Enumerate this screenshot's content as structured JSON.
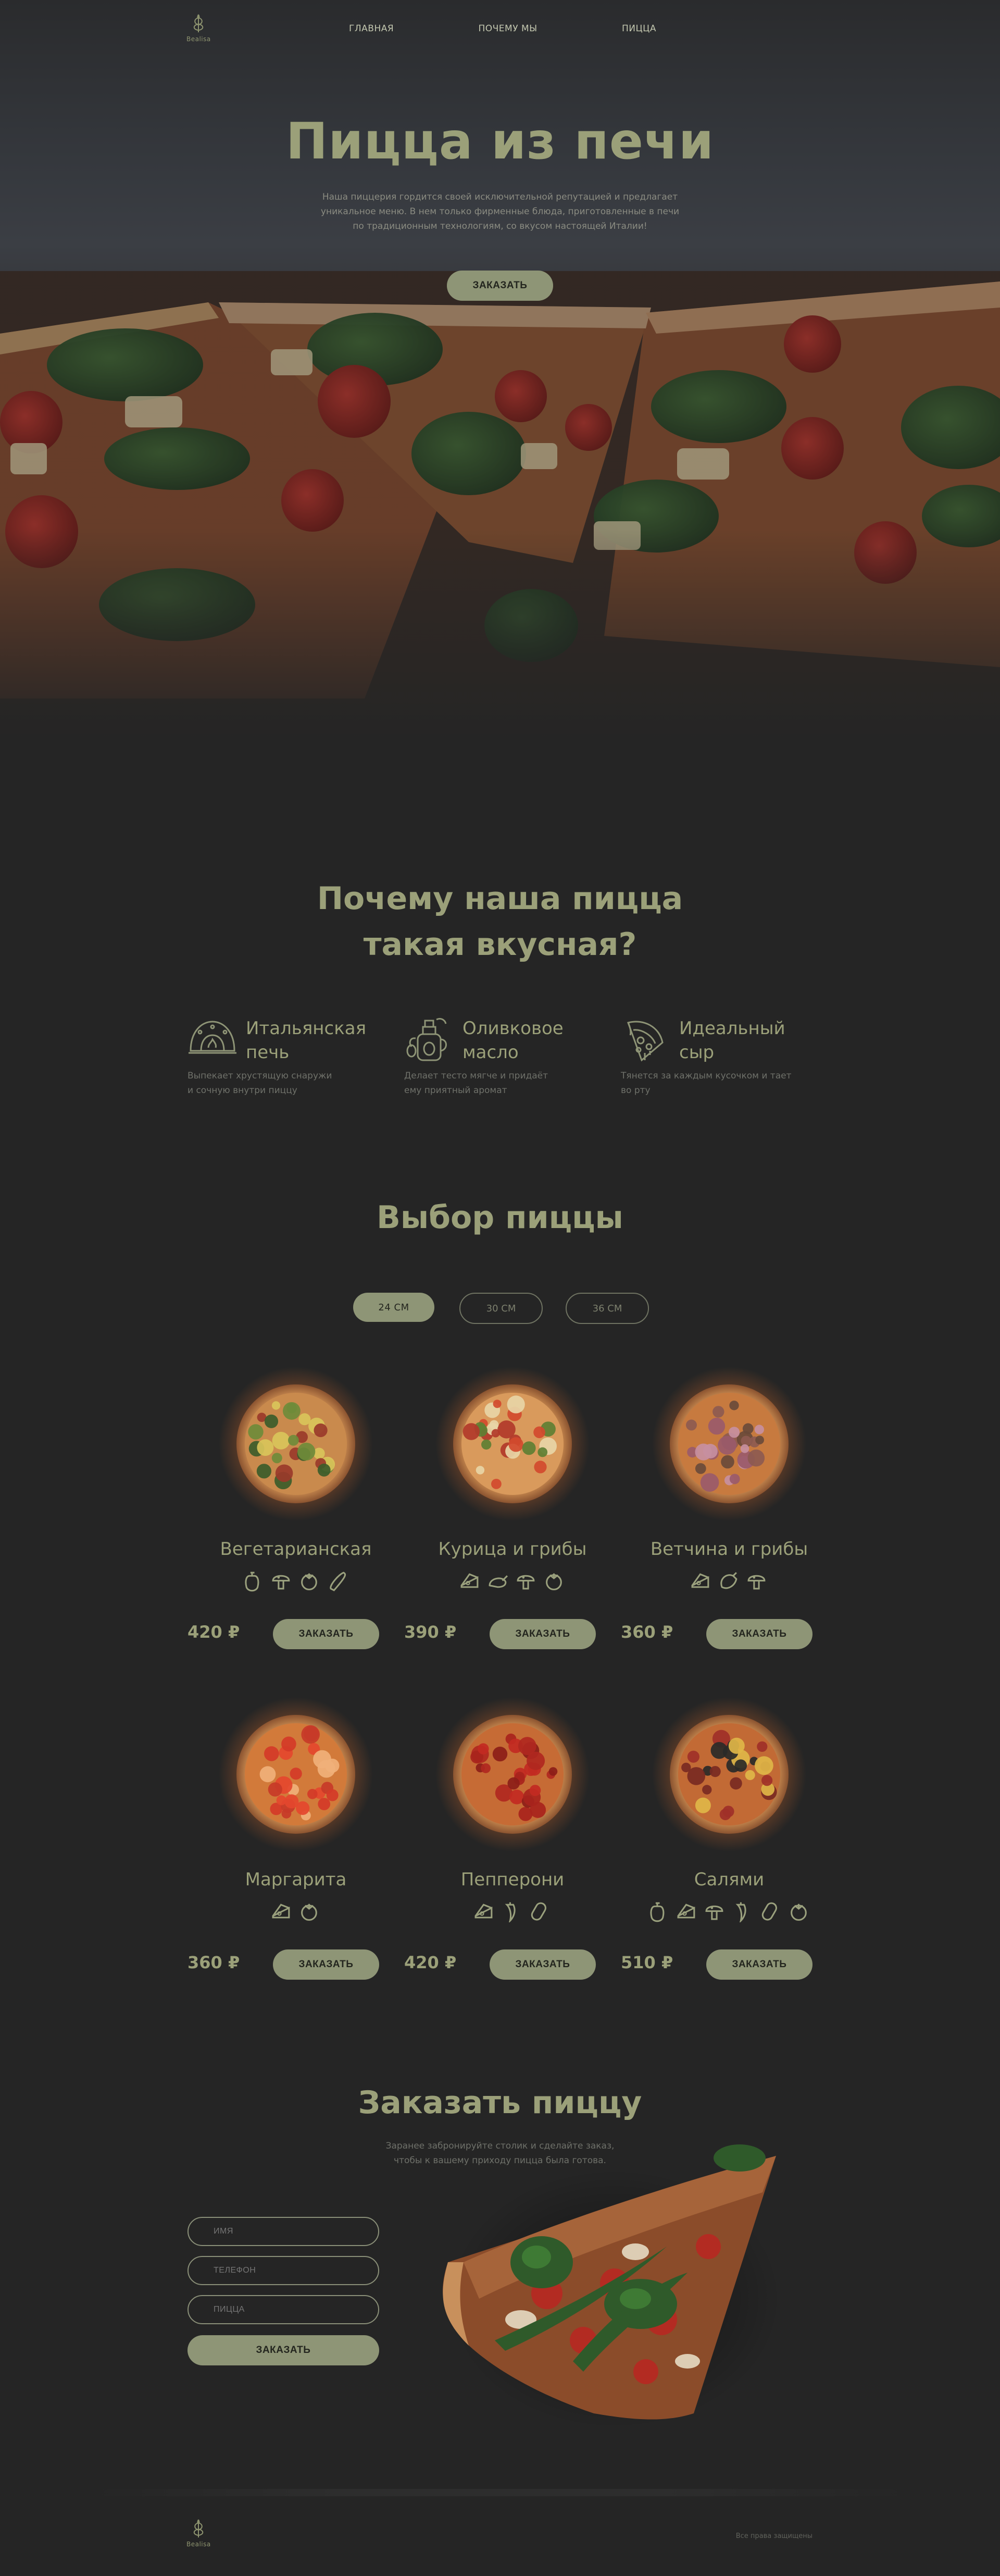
{
  "header": {
    "logo_text": "Bealisa",
    "nav": [
      "ГЛАВНАЯ",
      "ПОЧЕМУ МЫ",
      "ПИЦЦА"
    ]
  },
  "hero": {
    "title": "Пицца из печи",
    "subtitle_lines": [
      "Наша пиццерия гордится своей исключительной репутацией и предлагает",
      "уникальное меню. В нем только фирменные блюда, приготовленные в печи",
      "по традиционным технологиям, со вкусом настоящей Италии!"
    ],
    "cta": "ЗАКАЗАТЬ"
  },
  "why": {
    "title_lines": [
      "Почему наша пицца",
      "такая вкусная?"
    ],
    "features": [
      {
        "icon": "oven-icon",
        "title_lines": [
          "Итальянская",
          "печь"
        ],
        "desc_lines": [
          "Выпекает хрустящую снаружи",
          "и сочную внутри пиццу"
        ]
      },
      {
        "icon": "olive-oil-icon",
        "title_lines": [
          "Оливковое",
          "масло"
        ],
        "desc_lines": [
          "Делает тесто мягче и придаёт",
          "ему приятный аромат"
        ]
      },
      {
        "icon": "cheese-pizza-icon",
        "title_lines": [
          "Идеальный",
          "сыр"
        ],
        "desc_lines": [
          "Тянется за каждым кусочком и тает",
          "во рту"
        ]
      }
    ]
  },
  "menu": {
    "title": "Выбор пиццы",
    "sizes": [
      "24 СМ",
      "30 СМ",
      "36 СМ"
    ],
    "active_size": "24 СМ",
    "order_label": "ЗАКАЗАТЬ",
    "pizzas": [
      {
        "name": "Вегетарианская",
        "price": "420 ₽",
        "ingredients": [
          "pepper-icon",
          "mushroom-icon",
          "tomato-icon",
          "zucchini-icon"
        ]
      },
      {
        "name": "Курица и грибы",
        "price": "390 ₽",
        "ingredients": [
          "cheese-icon",
          "chicken-icon",
          "mushroom-icon",
          "tomato-icon"
        ]
      },
      {
        "name": "Ветчина и грибы",
        "price": "360 ₽",
        "ingredients": [
          "cheese-icon",
          "ham-icon",
          "mushroom-icon"
        ]
      },
      {
        "name": "Маргарита",
        "price": "360 ₽",
        "ingredients": [
          "cheese-icon",
          "tomato-icon"
        ]
      },
      {
        "name": "Пепперони",
        "price": "420 ₽",
        "ingredients": [
          "cheese-icon",
          "chili-icon",
          "sausage-icon"
        ]
      },
      {
        "name": "Салями",
        "price": "510 ₽",
        "ingredients": [
          "pepper-icon",
          "cheese-icon",
          "mushroom-icon",
          "chili-icon",
          "sausage-icon",
          "tomato-icon"
        ]
      }
    ]
  },
  "order": {
    "title": "Заказать пиццу",
    "subtitle_lines": [
      "Заранее забронируйте столик и сделайте заказ,",
      "чтобы к вашему приходу пицца была готова."
    ],
    "fields": [
      "ИМЯ",
      "ТЕЛЕФОН",
      "ПИЦЦА"
    ],
    "submit": "ЗАКАЗАТЬ"
  },
  "footer": {
    "logo_text": "Bealisa",
    "copyright": "Все права защищены"
  },
  "colors": {
    "accent": "#8e9576",
    "text": "#9ba079",
    "background": "#252525"
  }
}
